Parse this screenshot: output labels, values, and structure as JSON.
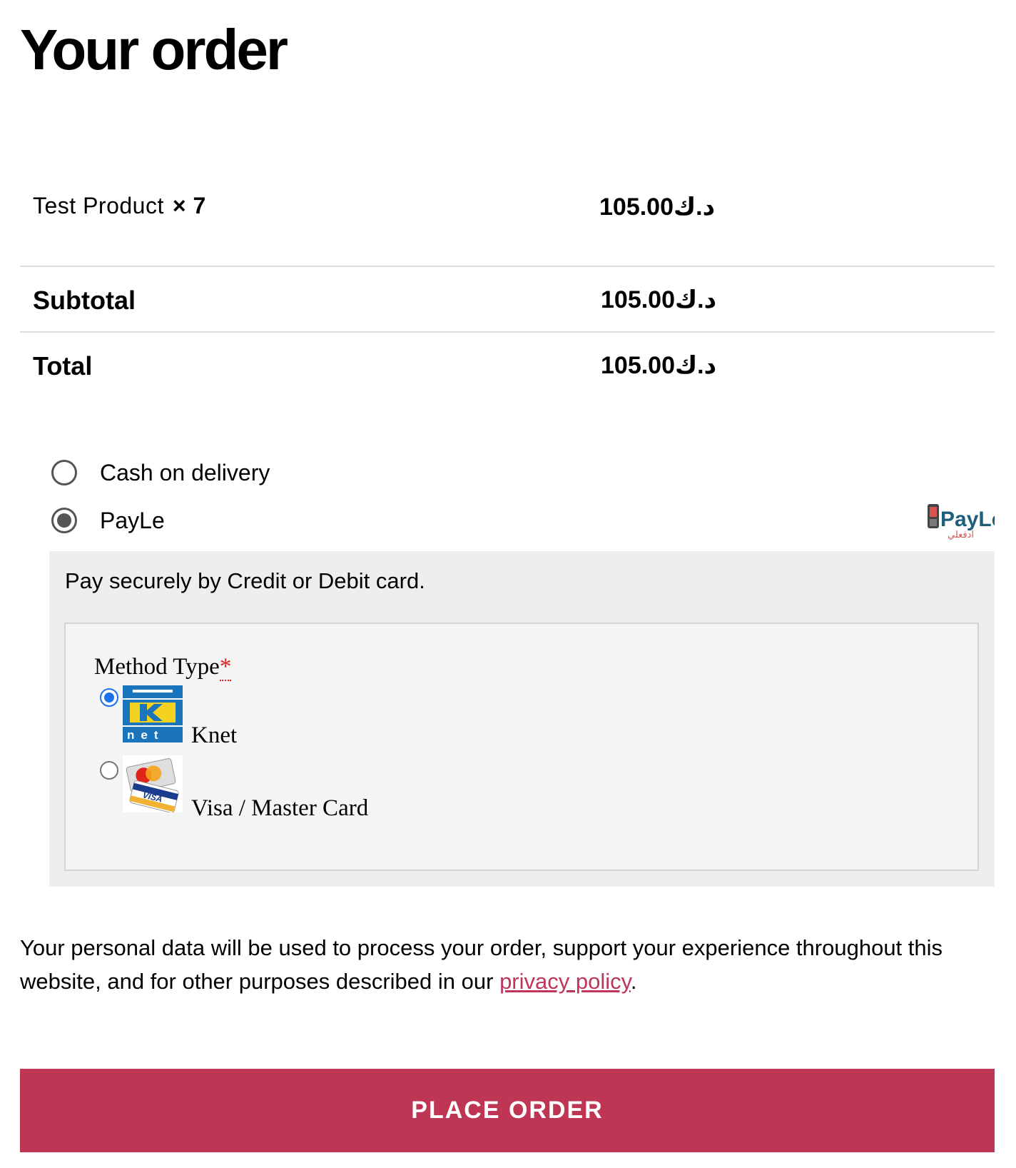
{
  "page": {
    "title": "Your order"
  },
  "order": {
    "item": {
      "name": "Test Product",
      "quantity": "× 7",
      "price": "105.00د.ك"
    },
    "subtotal": {
      "label": "Subtotal",
      "value": "105.00د.ك"
    },
    "total": {
      "label": "Total",
      "value": "105.00د.ك"
    }
  },
  "payment": {
    "options": [
      {
        "label": "Cash on delivery",
        "selected": false
      },
      {
        "label": "PayLe",
        "selected": true
      }
    ],
    "payle_logo": {
      "text": "PayLe",
      "arabic_text": "ادفعلي"
    },
    "description": "Pay securely by Credit or Debit card.",
    "method_type": {
      "label": "Method Type",
      "required_mark": "*",
      "methods": [
        {
          "label": "Knet",
          "selected": true,
          "icon": "knet-logo-icon"
        },
        {
          "label": "Visa / Master Card",
          "selected": false,
          "icon": "visa-mastercard-icon"
        }
      ]
    }
  },
  "privacy": {
    "text_before": "Your personal data will be used to process your order, support your experience throughout this website, and for other purposes described in our ",
    "link_text": "privacy policy",
    "text_after": "."
  },
  "actions": {
    "place_order_label": "PLACE ORDER"
  },
  "colors": {
    "accent": "#be3654",
    "link": "#c0365a",
    "panel": "#eeeeee",
    "radio_checked": "#1a73e8"
  }
}
